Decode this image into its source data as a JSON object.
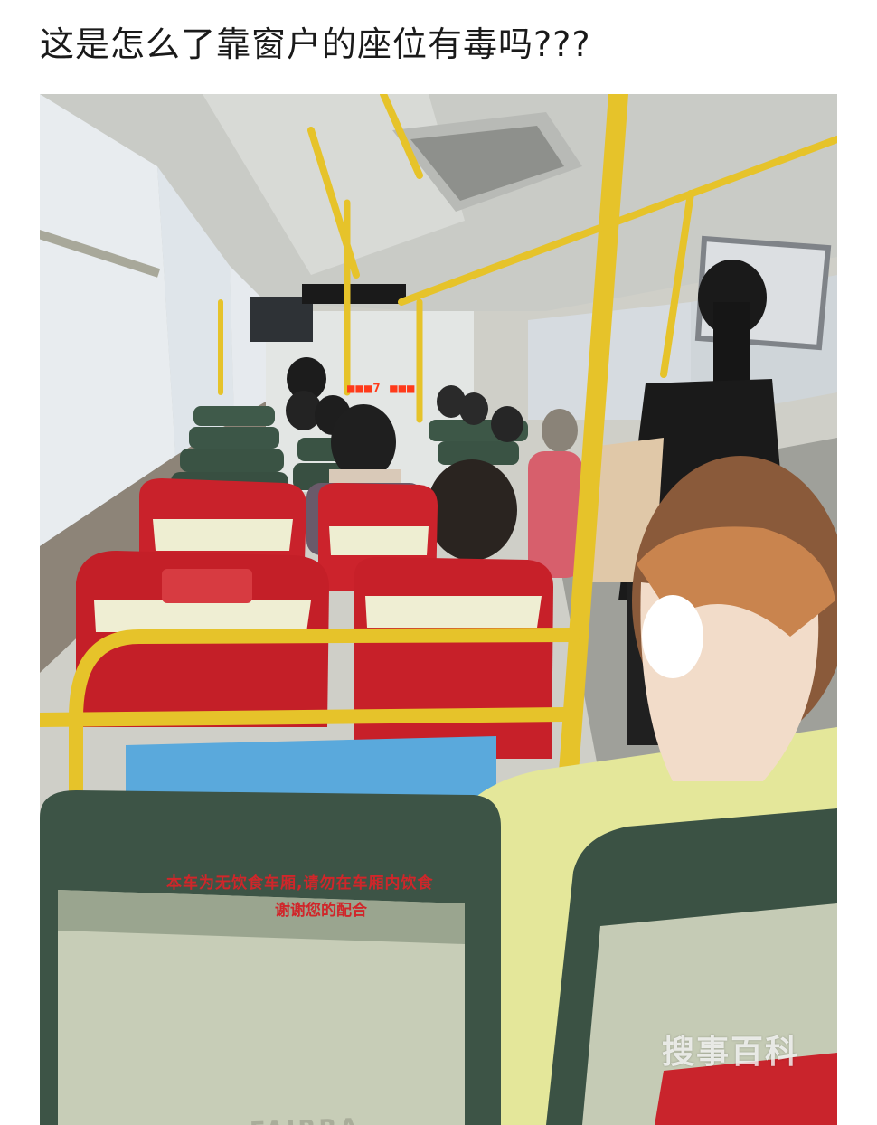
{
  "post": {
    "title": "这是怎么了靠窗户的座位有毒吗???"
  },
  "photo": {
    "led_display": "■■■7  ■■■",
    "sign_line1": "本车为无饮食车厢,请勿在车厢内饮食",
    "sign_line2": "谢谢您的配合",
    "seat_brand": "FAIRRA",
    "watermark": "搜事百科",
    "colors": {
      "seat_red": "#c8202a",
      "handrail_yellow": "#e6c32a",
      "seat_green": "#3d5446",
      "shirt_yellow": "#e6ea9a",
      "sign_blue": "#5aa9dc"
    }
  }
}
